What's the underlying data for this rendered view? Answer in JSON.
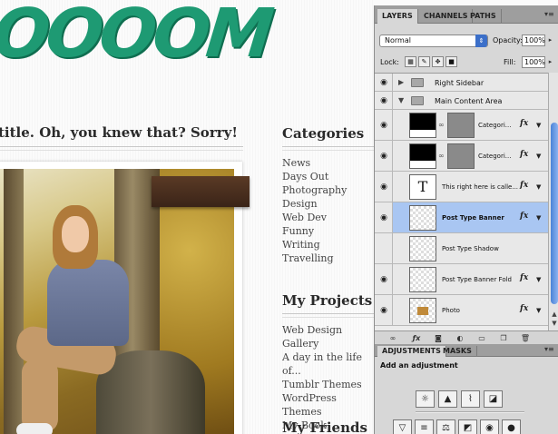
{
  "canvas": {
    "logo_text": "OOOOM",
    "post_title": "title. Oh, you knew that? Sorry!",
    "categories_heading": "Categories",
    "categories": [
      "News",
      "Days Out",
      "Photography",
      "Design",
      "Web Dev",
      "Funny",
      "Writing",
      "Travelling"
    ],
    "projects_heading": "My Projects",
    "projects": [
      "Web Design Gallery",
      "A day in the life of...",
      "Tumblr Themes",
      "WordPress Themes",
      "My Book"
    ],
    "friends_heading": "My Friends",
    "colors": {
      "logo": "#1e9a73",
      "text": "#2a2a2a"
    }
  },
  "panel": {
    "tabs": [
      "LAYERS",
      "CHANNELS",
      "PATHS"
    ],
    "active_tab": "LAYERS",
    "blend_mode": "Normal",
    "opacity_label": "Opacity:",
    "opacity_value": "100%",
    "lock_label": "Lock:",
    "fill_label": "Fill:",
    "fill_value": "100%",
    "layers": [
      {
        "name": "Right Sidebar",
        "kind": "group",
        "collapsed": true
      },
      {
        "name": "Main Content Area",
        "kind": "group",
        "collapsed": false
      },
      {
        "name": "Categori...",
        "kind": "shape",
        "fx": "fx"
      },
      {
        "name": "Categori...",
        "kind": "shape",
        "fx": "fx"
      },
      {
        "name": "This right here is calle...",
        "kind": "text",
        "thumb_text": "T",
        "fx": "fx"
      },
      {
        "name": "Post Type Banner",
        "kind": "pixel",
        "fx": "fx",
        "selected": true
      },
      {
        "name": "Post Type Shadow",
        "kind": "pixel"
      },
      {
        "name": "Post Type Banner Fold",
        "kind": "pixel",
        "fx": "fx"
      },
      {
        "name": "Photo",
        "kind": "photo",
        "fx": "fx"
      }
    ],
    "adjustments_tabs": [
      "ADJUSTMENTS",
      "MASKS"
    ],
    "adjustments_title": "Add an adjustment",
    "accent_color": "#3b6fc9",
    "selected_color": "#a9c6f2"
  }
}
